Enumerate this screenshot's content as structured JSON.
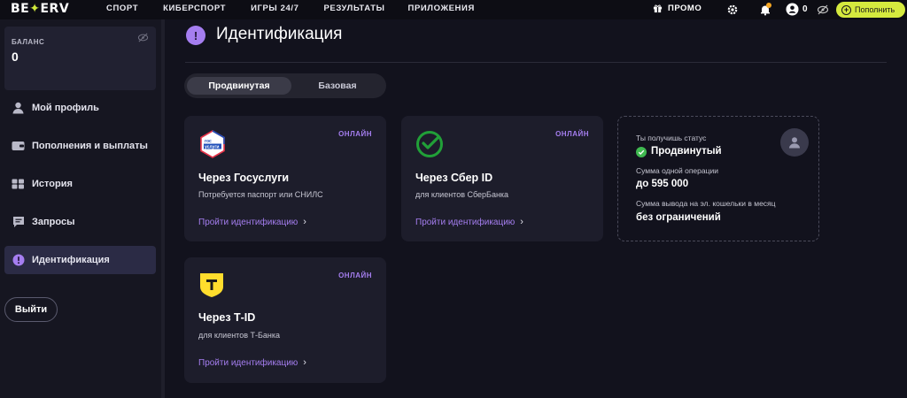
{
  "header": {
    "logo": "BETERV",
    "nav": [
      "СПОРТ",
      "КИБЕРСПОРТ",
      "ИГРЫ 24/7",
      "РЕЗУЛЬТАТЫ",
      "ПРИЛОЖЕНИЯ"
    ],
    "promo_label": "ПРОМО",
    "user_count": "0",
    "topup_label": "Пополнить"
  },
  "sidebar": {
    "balance_label": "БАЛАНС",
    "balance_value": "0",
    "items": [
      {
        "label": "Мой профиль",
        "icon": "user-icon"
      },
      {
        "label": "Пополнения и выплаты",
        "icon": "wallet-icon"
      },
      {
        "label": "История",
        "icon": "history-icon"
      },
      {
        "label": "Запросы",
        "icon": "chat-icon"
      },
      {
        "label": "Идентификация",
        "icon": "exclamation-icon",
        "active": true
      }
    ],
    "logout_label": "Выйти"
  },
  "main": {
    "title": "Идентификация",
    "tabs": [
      {
        "label": "Продвинутая",
        "active": true
      },
      {
        "label": "Базовая",
        "active": false
      }
    ],
    "cards": [
      {
        "badge": "ОНЛАЙН",
        "logo_text": "гос услуги",
        "title": "Через Госуслуги",
        "subtitle": "Потребуется паспорт или СНИЛС",
        "link": "Пройти идентификацию"
      },
      {
        "badge": "ОНЛАЙН",
        "title": "Через Сбер ID",
        "subtitle": "для клиентов СберБанка",
        "link": "Пройти идентификацию"
      },
      {
        "badge": "ОНЛАЙН",
        "logo_text": "Т",
        "title": "Через Т-ID",
        "subtitle": "для клиентов Т-Банка",
        "link": "Пройти идентификацию"
      }
    ],
    "status": {
      "label1": "Ты получишь статус",
      "value1": "Продвинутый",
      "label2": "Сумма одной операции",
      "value2": "до 595 000",
      "label3": "Сумма вывода на эл. кошельки в месяц",
      "value3": "без ограничений"
    }
  },
  "colors": {
    "accent": "#a57ef0",
    "topup": "#d5ea3e",
    "success": "#3fb950",
    "background": "#12121d"
  }
}
